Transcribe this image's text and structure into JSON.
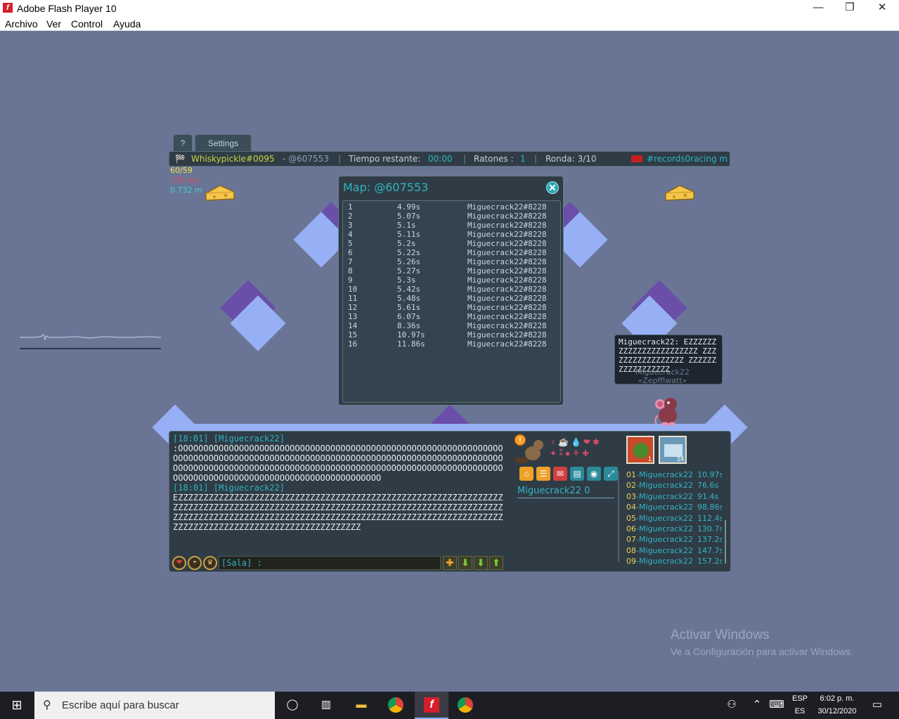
{
  "window": {
    "title": "Adobe Flash Player 10",
    "controls": {
      "minimize": "—",
      "maximize": "❐",
      "close": "✕"
    }
  },
  "menu": [
    "Archivo",
    "Ver",
    "Control",
    "Ayuda"
  ],
  "game": {
    "tabs": {
      "help": "?",
      "settings": "Settings"
    },
    "infobar": {
      "player": "Whiskypickle#0095",
      "map_code": "- @607553",
      "time_label": "Tiempo restante:",
      "time_value": "00:00",
      "mice_label": "Ratones :",
      "mice_value": "1",
      "round": "Ronda: 3/10",
      "room": "#records0racing m"
    },
    "stats": {
      "fps": "60/59",
      "ms": "133 ms",
      "mem": "0.732 m"
    },
    "map_panel": {
      "title": "Map: @607553",
      "close_glyph": "✕",
      "records": [
        {
          "rank": "1",
          "time": "4.99s",
          "player": "Miguecrack22#8228"
        },
        {
          "rank": "2",
          "time": "5.07s",
          "player": "Miguecrack22#8228"
        },
        {
          "rank": "3",
          "time": "5.1s",
          "player": "Miguecrack22#8228"
        },
        {
          "rank": "4",
          "time": "5.11s",
          "player": "Miguecrack22#8228"
        },
        {
          "rank": "5",
          "time": "5.2s",
          "player": "Miguecrack22#8228"
        },
        {
          "rank": "6",
          "time": "5.22s",
          "player": "Miguecrack22#8228"
        },
        {
          "rank": "7",
          "time": "5.26s",
          "player": "Miguecrack22#8228"
        },
        {
          "rank": "8",
          "time": "5.27s",
          "player": "Miguecrack22#8228"
        },
        {
          "rank": "9",
          "time": "5.3s",
          "player": "Miguecrack22#8228"
        },
        {
          "rank": "10",
          "time": "5.42s",
          "player": "Miguecrack22#8228"
        },
        {
          "rank": "11",
          "time": "5.48s",
          "player": "Miguecrack22#8228"
        },
        {
          "rank": "12",
          "time": "5.61s",
          "player": "Miguecrack22#8228"
        },
        {
          "rank": "13",
          "time": "6.07s",
          "player": "Miguecrack22#8228"
        },
        {
          "rank": "14",
          "time": "8.36s",
          "player": "Miguecrack22#8228"
        },
        {
          "rank": "15",
          "time": "10.97s",
          "player": "Miguecrack22#8228"
        },
        {
          "rank": "16",
          "time": "11.86s",
          "player": "Miguecrack22#8228"
        }
      ]
    },
    "bubble": {
      "text": "Miguecrack22: EZZZZZZ ZZZZZZZZZZZZZZZZZ ZZZZZZZZZZZZZZZZZ ZZZZZZZZZZZZZZZZZ"
    },
    "nametag": {
      "name": "Miguecrack22",
      "title": "«Zepfflwatt»"
    },
    "chat": {
      "messages": [
        {
          "stamp": "[18:01] [Miguecrack22]",
          "text": ":OOOOOOOOOOOOOOOOOOOOOOOOOOOOOOOOOOOOOOOOOOOOOOOOOOOOOOOOOOOOOOOOOOOOOOOOOOOOOOOOOOOOOOOOOOOOOOOOOOOOOOOOOOOOOOOOOOOOOOOOOOOOOOOOOOOOOOOOOOOOOOOOOOOOOOOOOOOOOOOOOOOOOOOOOOOOOOOOOOOOOOOOOOOOOOOOOOOOOOOOOOOOOOOOOOOOOOOOOOOOOOOOOOOOOOOOOOO"
        },
        {
          "stamp": "[18:01] [Miguecrack22]",
          "text": "EZZZZZZZZZZZZZZZZZZZZZZZZZZZZZZZZZZZZZZZZZZZZZZZZZZZZZZZZZZZZZZZZZZZZZZZZZZZZZZZZZZZZZZZZZZZZZZZZZZZZZZZZZZZZZZZZZZZZZZZZZZZZZZZZZZZZZZZZZZZZZZZZZZZZZZZZZZZZZZZZZZZZZZZZZZZZZZZZZZZZZZZZZZZZZZZZZZZZZZZZZZZZZZZZZZZZZZZZZZZZZZZZZZZZZZZ"
        }
      ],
      "input_placeholder": "[Sala] :"
    },
    "player_panel": {
      "name": "Miguecrack22",
      "score": "0",
      "badge1_count": "1",
      "badge2_count": "24"
    },
    "ranking": [
      {
        "num": "01",
        "name": "-Miguecrack22",
        "time": "10.97s"
      },
      {
        "num": "02",
        "name": "-Miguecrack22",
        "time": "76.6s"
      },
      {
        "num": "03",
        "name": "-Miguecrack22",
        "time": "91.4s"
      },
      {
        "num": "04",
        "name": "-Miguecrack22",
        "time": "98.86s"
      },
      {
        "num": "05",
        "name": "-Miguecrack22",
        "time": "112.4s"
      },
      {
        "num": "06",
        "name": "-Miguecrack22",
        "time": "130.7s"
      },
      {
        "num": "07",
        "name": "-Miguecrack22",
        "time": "137.2s"
      },
      {
        "num": "08",
        "name": "-Miguecrack22",
        "time": "147.7s"
      },
      {
        "num": "09",
        "name": "-Miguecrack22",
        "time": "157.2s"
      }
    ]
  },
  "watermark": {
    "line1": "Activar Windows",
    "line2": "Ve a Configuración para activar Windows."
  },
  "taskbar": {
    "search_placeholder": "Escribe aquí para buscar",
    "lang_top": "ESP",
    "lang_bottom": "ES",
    "time": "6:02 p. m.",
    "date": "30/12/2020"
  },
  "colors": {
    "stage": "#6a7596",
    "accent": "#2fb3c3",
    "panel": "#2f3c45"
  }
}
